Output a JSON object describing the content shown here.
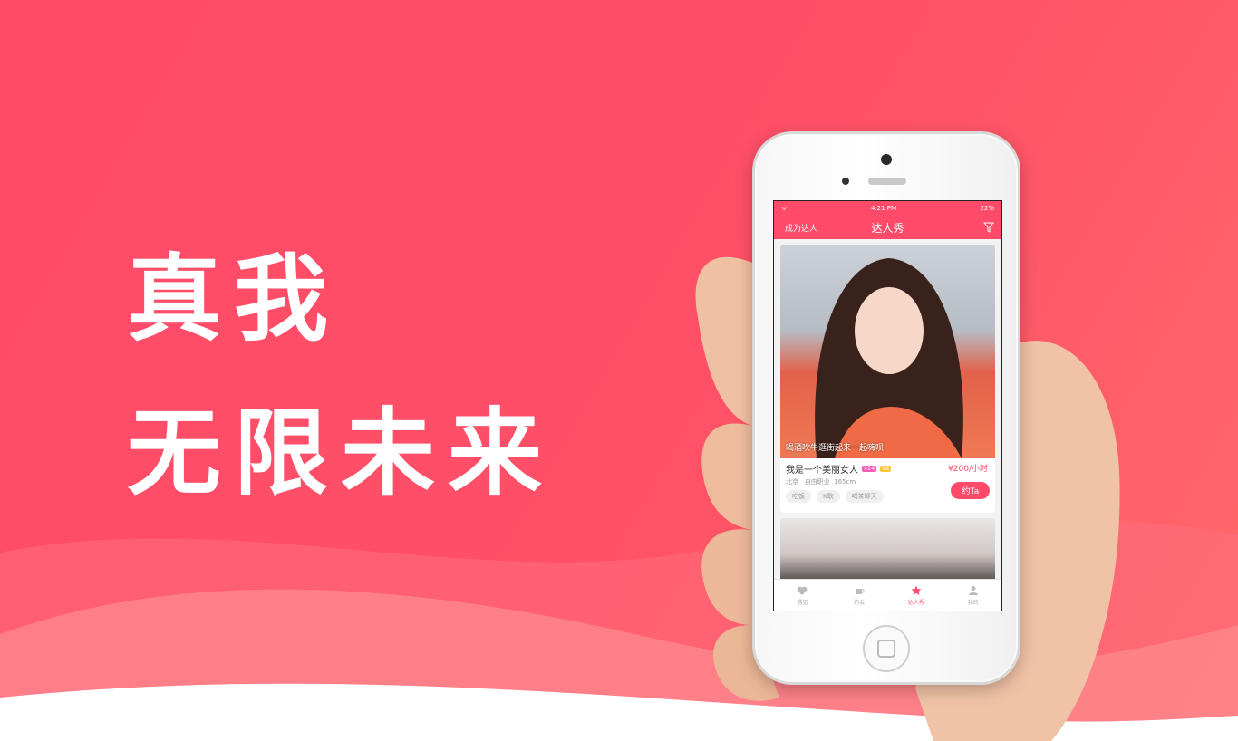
{
  "hero": {
    "line1": "真我",
    "line2": "无限未来"
  },
  "phone": {
    "statusbar": {
      "signal": "ᯤ",
      "time": "4:21 PM",
      "battery": "22%"
    },
    "navbar": {
      "left_label": "成为达人",
      "title": "达人秀",
      "filter_icon": "filter-icon"
    },
    "card": {
      "caption": "喝酒吹牛逛街起来一起嗨呗",
      "name": "我是一个美丽女人",
      "badge_age": "♀24",
      "badge_level": "V8",
      "price": "¥200/小时",
      "location": "北京",
      "job": "自由职业",
      "height": "165cm",
      "tags": [
        "吃饭",
        "K歌",
        "喝茶聊天"
      ],
      "book_label": "约Ta"
    },
    "tabs": [
      {
        "label": "遇见",
        "icon": "heart-icon"
      },
      {
        "label": "约会",
        "icon": "coffee-icon"
      },
      {
        "label": "达人秀",
        "icon": "star-icon",
        "active": true
      },
      {
        "label": "我的",
        "icon": "person-icon"
      }
    ]
  },
  "colors": {
    "accent": "#ff4a6a",
    "background": "#ff5068"
  }
}
